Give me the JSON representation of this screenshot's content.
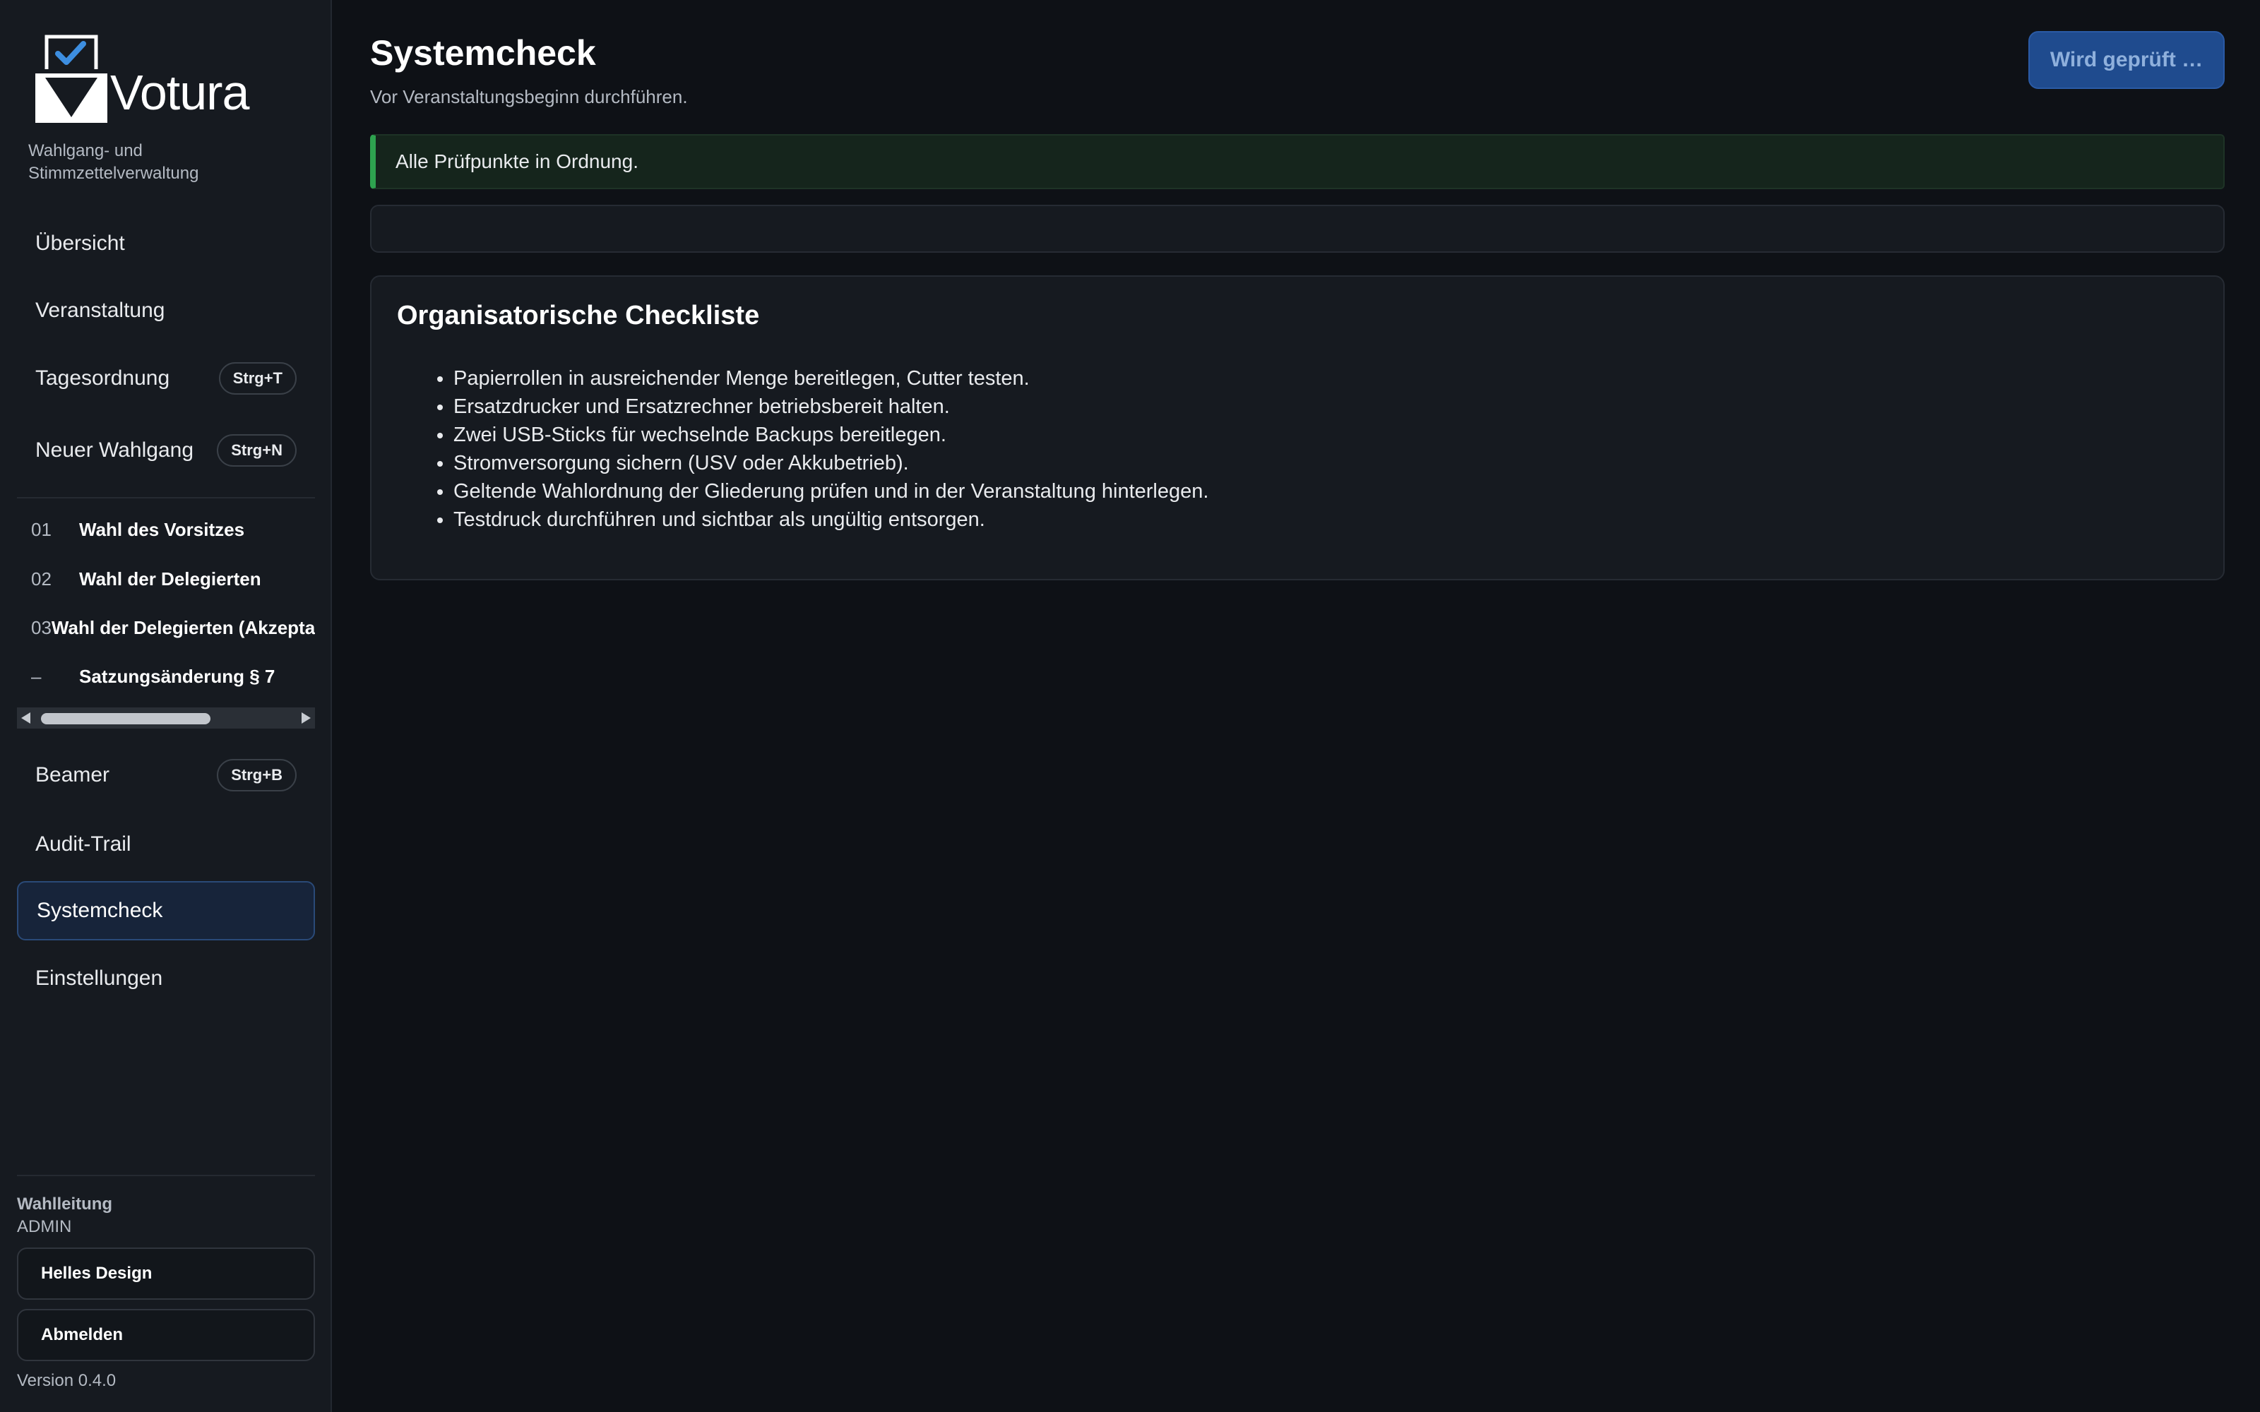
{
  "app": {
    "name": "Votura",
    "tagline": "Wahlgang- und Stimmzettelverwaltung"
  },
  "sidebar": {
    "nav": [
      {
        "label": "Übersicht"
      },
      {
        "label": "Veranstaltung"
      },
      {
        "label": "Tagesordnung",
        "shortcut": "Strg+T"
      },
      {
        "label": "Neuer Wahlgang",
        "shortcut": "Strg+N"
      }
    ],
    "ballots": [
      {
        "num": "01",
        "title": "Wahl des Vorsitzes"
      },
      {
        "num": "02",
        "title": "Wahl der Delegierten"
      },
      {
        "num": "03",
        "title": "Wahl der Delegierten (Akzeptanz)"
      },
      {
        "num": "–",
        "title": "Satzungsänderung § 7"
      }
    ],
    "nav_bottom": [
      {
        "label": "Beamer",
        "shortcut": "Strg+B"
      },
      {
        "label": "Audit-Trail"
      },
      {
        "label": "Systemcheck",
        "active": true
      },
      {
        "label": "Einstellungen"
      }
    ],
    "user": {
      "role": "Wahlleitung",
      "level": "ADMIN"
    },
    "theme_button": "Helles Design",
    "logout_button": "Abmelden",
    "version": "Version 0.4.0"
  },
  "main": {
    "title": "Systemcheck",
    "subtitle": "Vor Veranstaltungsbeginn durchführen.",
    "check_button": "Wird geprüft …",
    "alert": "Alle Prüfpunkte in Ordnung.",
    "checklist": {
      "title": "Organisatorische Checkliste",
      "items": [
        "Papierrollen in ausreichender Menge bereitlegen, Cutter testen.",
        "Ersatzdrucker und Ersatzrechner betriebsbereit halten.",
        "Zwei USB-Sticks für wechselnde Backups bereitlegen.",
        "Stromversorgung sichern (USV oder Akkubetrieb).",
        "Geltende Wahlordnung der Gliederung prüfen und in der Veranstaltung hinterlegen.",
        "Testdruck durchführen und sichtbar als ungültig entsorgen."
      ]
    }
  },
  "colors": {
    "background": "#0e1116",
    "sidebar": "#161a20",
    "accent": "#1f4b8e",
    "success": "#2ea34f",
    "logo_check": "#3d8ee0"
  }
}
